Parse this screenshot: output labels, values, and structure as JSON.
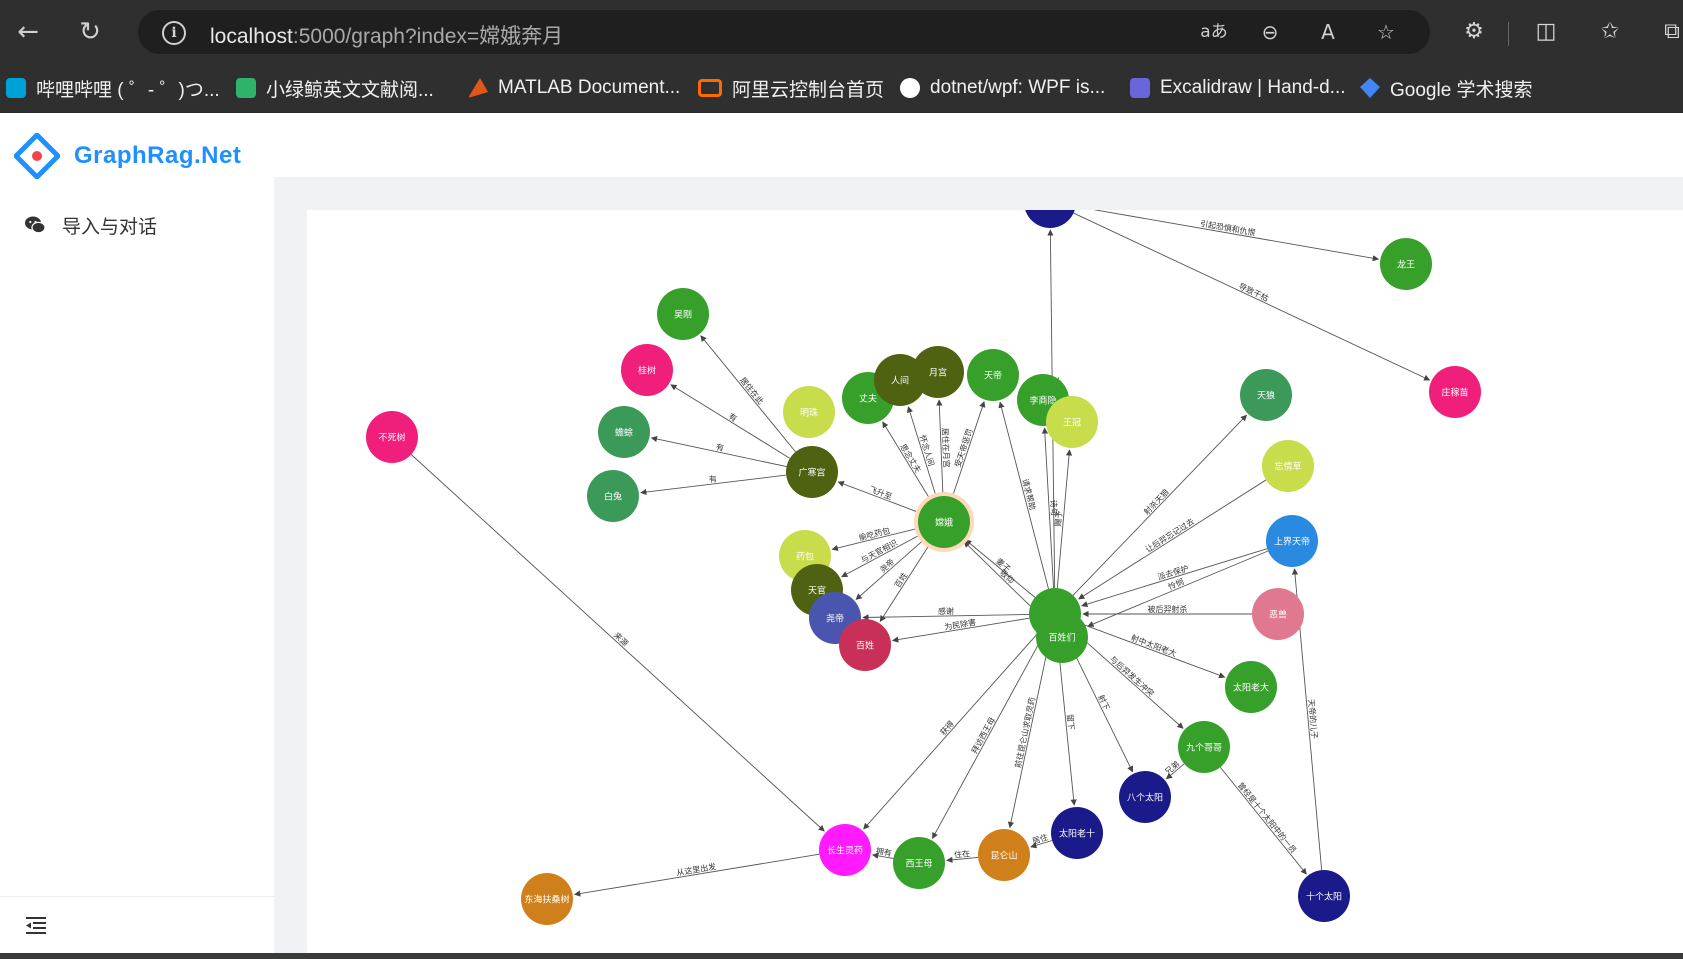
{
  "browser": {
    "url_host": "localhost",
    "url_path": ":5000/graph?index=嫦娥奔月",
    "translate_icon_text": "aあ",
    "read_aloud_icon_text": "A",
    "bookmarks": [
      {
        "label": "哔哩哔哩 ( ゜- ゜)つ...",
        "color": "#00a1d6"
      },
      {
        "label": "小绿鲸英文文献阅...",
        "color": "#2fb36b"
      },
      {
        "label": "MATLAB Document...",
        "color": "#e2561c"
      },
      {
        "label": "阿里云控制台首页",
        "color": "#ff6a00"
      },
      {
        "label": "dotnet/wpf: WPF is...",
        "color": "#ffffff"
      },
      {
        "label": "Excalidraw | Hand-d...",
        "color": "#6965db"
      },
      {
        "label": "Google 学术搜索",
        "color": "#4285f4"
      }
    ]
  },
  "app": {
    "brand": "GraphRag.Net",
    "brand_color": "#1e90ff",
    "menu": [
      {
        "label": "导入与对话",
        "icon": "wechat-icon"
      }
    ]
  },
  "graph": {
    "nodes": [
      {
        "id": "top",
        "label": "",
        "color": "#1a1a8a"
      },
      {
        "id": "longwang",
        "label": "龙王",
        "color": "#36a02a"
      },
      {
        "id": "zhuangjia",
        "label": "庄稼苗",
        "color": "#ef1f7b"
      },
      {
        "id": "wugang",
        "label": "吴刚",
        "color": "#36a02a"
      },
      {
        "id": "guishu",
        "label": "桂树",
        "color": "#ef1f7b"
      },
      {
        "id": "chanchu",
        "label": "蟾蜍",
        "color": "#3b9a5a"
      },
      {
        "id": "baitu",
        "label": "白兔",
        "color": "#3b9a5a"
      },
      {
        "id": "busishu",
        "label": "不死树",
        "color": "#ef1f7b"
      },
      {
        "id": "guanghangong",
        "label": "广寒宫",
        "color": "#4e6212"
      },
      {
        "id": "mingzhu",
        "label": "明珠",
        "color": "#c8dc4c"
      },
      {
        "id": "zhangfu",
        "label": "丈夫",
        "color": "#36a02a"
      },
      {
        "id": "renjian",
        "label": "人间",
        "color": "#4e6212"
      },
      {
        "id": "yuegong",
        "label": "月宫",
        "color": "#4e6212"
      },
      {
        "id": "tiandi",
        "label": "天帝",
        "color": "#36a02a"
      },
      {
        "id": "lishangyin",
        "label": "李商隐",
        "color": "#36a02a"
      },
      {
        "id": "wangjian",
        "label": "王冠",
        "color": "#c8dc4c"
      },
      {
        "id": "tianlang",
        "label": "天狼",
        "color": "#3b9a5a"
      },
      {
        "id": "wangqingcao",
        "label": "忘情草",
        "color": "#c8dc4c"
      },
      {
        "id": "shangjie",
        "label": "上界天帝",
        "color": "#2a8ae0"
      },
      {
        "id": "exing",
        "label": "恶兽",
        "color": "#e07890"
      },
      {
        "id": "change",
        "label": "嫦娥",
        "color": "#36a02a"
      },
      {
        "id": "yaobao",
        "label": "药包",
        "color": "#c8dc4c"
      },
      {
        "id": "tianguan",
        "label": "天官",
        "color": "#4e6212"
      },
      {
        "id": "yaodi",
        "label": "尧帝",
        "color": "#4a55b0"
      },
      {
        "id": "baixing1",
        "label": "百姓",
        "color": "#c83058"
      },
      {
        "id": "hub",
        "label": "",
        "color": "#36a02a"
      },
      {
        "id": "baixing2",
        "label": "百姓们",
        "color": "#36a02a"
      },
      {
        "id": "taiyanglaoda",
        "label": "太阳老大",
        "color": "#36a02a"
      },
      {
        "id": "jiugegege",
        "label": "九个哥哥",
        "color": "#36a02a"
      },
      {
        "id": "bagetaiyang",
        "label": "八个太阳",
        "color": "#1a1a8a"
      },
      {
        "id": "taiyanglaoshi",
        "label": "太阳老十",
        "color": "#1a1a8a"
      },
      {
        "id": "kunlunshan",
        "label": "昆仑山",
        "color": "#d0801a"
      },
      {
        "id": "xiwangmu",
        "label": "西王母",
        "color": "#36a02a"
      },
      {
        "id": "changsheng",
        "label": "长生灵药",
        "color": "#ff1aff"
      },
      {
        "id": "donghai",
        "label": "东海扶桑树",
        "color": "#d0801a"
      },
      {
        "id": "shigetaiyang",
        "label": "十个太阳",
        "color": "#1a1a8a"
      }
    ],
    "edges": [
      {
        "from": "top",
        "to": "longwang",
        "label": "引起恐惧和仇恨"
      },
      {
        "from": "top",
        "to": "zhuangjia",
        "label": "导致干枯"
      },
      {
        "from": "guanghangong",
        "to": "wugang",
        "label": "居住在此"
      },
      {
        "from": "guanghangong",
        "to": "guishu",
        "label": "有"
      },
      {
        "from": "guanghangong",
        "to": "chanchu",
        "label": "有"
      },
      {
        "from": "guanghangong",
        "to": "baitu",
        "label": "有"
      },
      {
        "from": "busishu",
        "to": "changsheng",
        "label": "来源"
      },
      {
        "from": "change",
        "to": "guanghangong",
        "label": "飞升至"
      },
      {
        "from": "change",
        "to": "zhangfu",
        "label": "思念丈夫"
      },
      {
        "from": "change",
        "to": "renjian",
        "label": "怀念人间"
      },
      {
        "from": "change",
        "to": "yuegong",
        "label": "居住在月宫"
      },
      {
        "from": "change",
        "to": "tiandi",
        "label": "受天帝惩罚"
      },
      {
        "from": "change",
        "to": "yaobao",
        "label": "偷吃药包"
      },
      {
        "from": "change",
        "to": "tianguan",
        "label": "与天官相识"
      },
      {
        "from": "change",
        "to": "yaodi",
        "label": "尧帝"
      },
      {
        "from": "change",
        "to": "baixing1",
        "label": "百姓"
      },
      {
        "from": "hub",
        "to": "top",
        "label": "太阳是天帝的儿子"
      },
      {
        "from": "hub",
        "to": "tiandi",
        "label": "请求帮助"
      },
      {
        "from": "hub",
        "to": "lishangyin",
        "label": "诗句"
      },
      {
        "from": "hub",
        "to": "wangjian",
        "label": "赐予"
      },
      {
        "from": "hub",
        "to": "tianlang",
        "label": "射杀天狼"
      },
      {
        "from": "wangqingcao",
        "to": "hub",
        "label": "让后羿忘记过去"
      },
      {
        "from": "shangjie",
        "to": "hub",
        "label": "派去保护"
      },
      {
        "from": "exing",
        "to": "hub",
        "label": "被后羿射杀"
      },
      {
        "from": "hub",
        "to": "taiyanglaoda",
        "label": "射中太阳老大"
      },
      {
        "from": "hub",
        "to": "jiugegege",
        "label": "与后羿发生冲突"
      },
      {
        "from": "hub",
        "to": "bagetaiyang",
        "label": "射下"
      },
      {
        "from": "hub",
        "to": "taiyanglaoshi",
        "label": "留下"
      },
      {
        "from": "hub",
        "to": "kunlunshan",
        "label": "前往昆仑山求取灵药"
      },
      {
        "from": "hub",
        "to": "xiwangmu",
        "label": "拜访西王母"
      },
      {
        "from": "hub",
        "to": "changsheng",
        "label": "获得"
      },
      {
        "from": "hub",
        "to": "yaodi",
        "label": "感谢"
      },
      {
        "from": "hub",
        "to": "baixing1",
        "label": "为民除害"
      },
      {
        "from": "hub",
        "to": "change",
        "label": "妻子"
      },
      {
        "from": "baixing2",
        "to": "change",
        "label": "敬仰"
      },
      {
        "from": "jiugegege",
        "to": "bagetaiyang",
        "label": "兄弟"
      },
      {
        "from": "jiugegege",
        "to": "shigetaiyang",
        "label": "曾经是十个太阳中的一员"
      },
      {
        "from": "shigetaiyang",
        "to": "shangjie",
        "label": "天帝的儿子"
      },
      {
        "from": "xiwangmu",
        "to": "changsheng",
        "label": "拥有"
      },
      {
        "from": "changsheng",
        "to": "donghai",
        "label": "从这里出发"
      },
      {
        "from": "taiyanglaoshi",
        "to": "kunlunshan",
        "label": "居住"
      },
      {
        "from": "kunlunshan",
        "to": "xiwangmu",
        "label": "住在"
      },
      {
        "from": "shangjie",
        "to": "baixing2",
        "label": "怜悯"
      }
    ]
  }
}
